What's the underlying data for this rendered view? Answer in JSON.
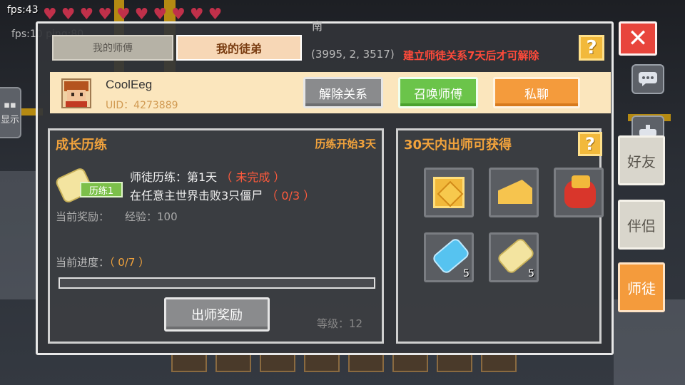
{
  "hud": {
    "fps": "fps:43",
    "fps_ping": "fps:10 ping:80",
    "compass": "南",
    "coords": "(3995, 2, 3517)",
    "level": "等级：12",
    "hearts": 10
  },
  "side_hint": {
    "label": "显示"
  },
  "dialog": {
    "tabs": [
      "我的师傅",
      "我的徒弟"
    ],
    "active_tab": 1,
    "warning": "建立师徒关系7天后才可解除",
    "help_icon": "?",
    "user": {
      "name": "CoolEeg",
      "uid": "UID：4273889"
    },
    "buttons": {
      "dissolve": "解除关系",
      "summon": "召唤师傅",
      "chat": "私聊"
    },
    "growth": {
      "title": "成长历练",
      "note": "历练开始3天",
      "scroll_tag": "历练1",
      "task_title": "师徒历练：第1天",
      "task_status": "（ 未完成 ）",
      "task_desc": "在任意主世界击败3只僵尸",
      "task_count": "（ 0/3 ）",
      "reward_label": "当前奖励：",
      "reward_value": "经验：100",
      "progress_label": "当前进度：",
      "progress_value": "（ 0/7 ）",
      "progress_fraction": 0,
      "graduate_button": "出师奖励"
    },
    "rewards": {
      "title": "30天内出师可获得",
      "items": [
        {
          "icon": "golden-frame-icon",
          "count": ""
        },
        {
          "icon": "cheese-icon",
          "count": ""
        },
        {
          "icon": "gift-bag-icon",
          "count": ""
        },
        {
          "icon": "blue-scroll-icon",
          "count": "5"
        },
        {
          "icon": "yellow-scroll-icon",
          "count": "5"
        }
      ]
    }
  },
  "side_menu": {
    "close": "✕",
    "items": [
      "好友",
      "伴侣",
      "师徒"
    ],
    "active": 2
  },
  "colors": {
    "accent_orange": "#f49b3c",
    "warning_red": "#ff4a3a",
    "summon_green": "#6bc44a",
    "close_red": "#e8453c"
  }
}
